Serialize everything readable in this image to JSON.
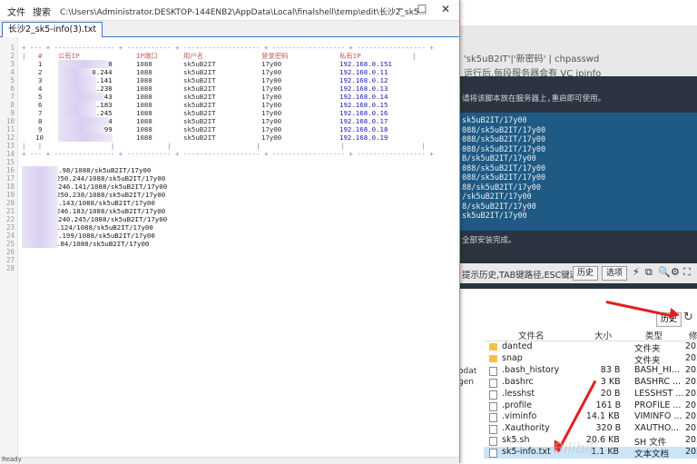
{
  "editor": {
    "menu": [
      "文件",
      "搜索"
    ],
    "path": "C:\\Users\\Administrator.DESKTOP-144ENB2\\AppData\\Local\\finalshell\\temp\\edit\\长沙2_sk5...",
    "tab_label": "长沙2_sk5-info(3).txt",
    "line_numbers": [
      "1",
      "2",
      "3",
      "4",
      "5",
      "6",
      "7",
      "8",
      "9",
      "10",
      "11",
      "12",
      "13",
      "14",
      "15",
      "16",
      "17",
      "18",
      "19",
      "20",
      "21",
      "22",
      "23",
      "24",
      "25",
      "26",
      "27",
      "28"
    ],
    "table_border": "+ --- + --------------- + ----------- + ------------------- + ------------------ + ----------------- +",
    "table_header": {
      "pipe": "|",
      "num": "#",
      "ip": "公有IP",
      "port": "IP端口",
      "user": "用户名",
      "pass": "登录密码",
      "private": "私有IP"
    },
    "rows": [
      {
        "n": "1",
        "ip": "82.98",
        "port": "1088",
        "user": "sk5uB2IT",
        "pass": "17y00",
        "private": "192.168.0.151"
      },
      {
        "n": "2",
        "ip": "9.250.244",
        "port": "1088",
        "user": "sk5uB2IT",
        "pass": "17y00",
        "private": "192.168.0.11"
      },
      {
        "n": "3",
        "ip": ".246.141",
        "port": "1088",
        "user": "sk5uB2IT",
        "pass": "17y00",
        "private": "192.168.0.12"
      },
      {
        "n": "4",
        "ip": ".250.238",
        "port": "1088",
        "user": "sk5uB2IT",
        "pass": "17y00",
        "private": "192.168.0.13"
      },
      {
        "n": "5",
        "ip": "35.143",
        "port": "1088",
        "user": "sk5uB2IT",
        "pass": "17y00",
        "private": "192.168.0.14"
      },
      {
        "n": "6",
        "ip": ".246.183",
        "port": "1088",
        "user": "sk5uB2IT",
        "pass": "17y00",
        "private": "192.168.0.15"
      },
      {
        "n": "7",
        "ip": ".240.245",
        "port": "1088",
        "user": "sk5uB2IT",
        "pass": "17y00",
        "private": "192.168.0.16"
      },
      {
        "n": "8",
        "ip": "9.124",
        "port": "1088",
        "user": "sk5uB2IT",
        "pass": "17y00",
        "private": "192.168.0.17"
      },
      {
        "n": "9",
        "ip": "35.199",
        "port": "1088",
        "user": "sk5uB2IT",
        "pass": "17y00",
        "private": "192.168.0.18"
      },
      {
        "n": "10",
        "ip": "1.84",
        "port": "1088",
        "user": "sk5uB2IT",
        "pass": "17y00",
        "private": "192.168.0.19"
      }
    ],
    "list": [
      ".98/1088/sk5uB2IT/17y00",
      "250.244/1088/sk5uB2IT/17y00",
      "246.141/1088/sk5uB2IT/17y00",
      "250.238/1088/sk5uB2IT/17y00",
      ".143/1088/sk5uB2IT/17y00",
      "246.183/1088/sk5uB2IT/17y00",
      "240.245/1088/sk5uB2IT/17y00",
      ".124/1088/sk5uB2IT/17y00",
      ".199/1088/sk5uB2IT/17y00",
      ".84/1088/sk5uB2IT/17y00"
    ],
    "status": "Ready"
  },
  "terminal": {
    "top_lines": [
      "'sk5uB2IT'|'新密码' | chpasswd",
      "运行后,每段服务器会有 VC ipinfo"
    ],
    "mid_line": "请将该脚本放在服务器上,重启即可使用。",
    "blue_lines": [
      "sk5uB2IT/17y00",
      "088/sk5uB2IT/17y00",
      "088/sk5uB2IT/17y00",
      "088/sk5uB2IT/17y00",
      "B/sk5uB2IT/17y00",
      "088/sk5uB2IT/17y00",
      "088/sk5uB2IT/17y00",
      "88/sk5uB2IT/17y00",
      "/sk5uB2IT/17y00",
      "8/sk5uB2IT/17y00",
      "sk5uB2IT/17y00"
    ],
    "done_line": "全部安装完成。",
    "cmd_hint": "提示历史,TAB键路径,ESC键返回",
    "history_btn": "历史",
    "options_btn": "选项"
  },
  "files": {
    "history_btn": "历史",
    "left_cut": [
      "odat",
      "gen"
    ],
    "headers": {
      "name": "文件名",
      "size": "大小",
      "type": "类型",
      "date": "修"
    },
    "rows": [
      {
        "name": "danted",
        "size": "",
        "type": "文件夹",
        "date": "202",
        "kind": "folder"
      },
      {
        "name": "snap",
        "size": "",
        "type": "文件夹",
        "date": "202",
        "kind": "folder"
      },
      {
        "name": ".bash_history",
        "size": "83 B",
        "type": "BASH_HI...",
        "date": "202",
        "kind": "doc"
      },
      {
        "name": ".bashrc",
        "size": "3 KB",
        "type": "BASHRC ...",
        "date": "202",
        "kind": "doc"
      },
      {
        "name": ".lesshst",
        "size": "20 B",
        "type": "LESSHST ...",
        "date": "202",
        "kind": "doc"
      },
      {
        "name": ".profile",
        "size": "161 B",
        "type": "PROFILE ...",
        "date": "201",
        "kind": "doc"
      },
      {
        "name": ".viminfo",
        "size": "14.1 KB",
        "type": "VIMINFO ...",
        "date": "202",
        "kind": "doc"
      },
      {
        "name": ".Xauthority",
        "size": "320 B",
        "type": "XAUTHO...",
        "date": "202",
        "kind": "doc"
      },
      {
        "name": "sk5.sh",
        "size": "20.6 KB",
        "type": "SH 文件",
        "date": "202",
        "kind": "doc"
      },
      {
        "name": "sk5-info.txt",
        "size": "1.1 KB",
        "type": "文本文档",
        "date": "202",
        "kind": "doc"
      }
    ]
  },
  "watermark": "Bilibili",
  "colors": {
    "tab_blue": "#3b78c4",
    "terminal_bg": "#2b3440",
    "terminal_blue": "#1f5a84",
    "arrow_red": "#e02020",
    "border_purple": "#9e6dc0"
  }
}
